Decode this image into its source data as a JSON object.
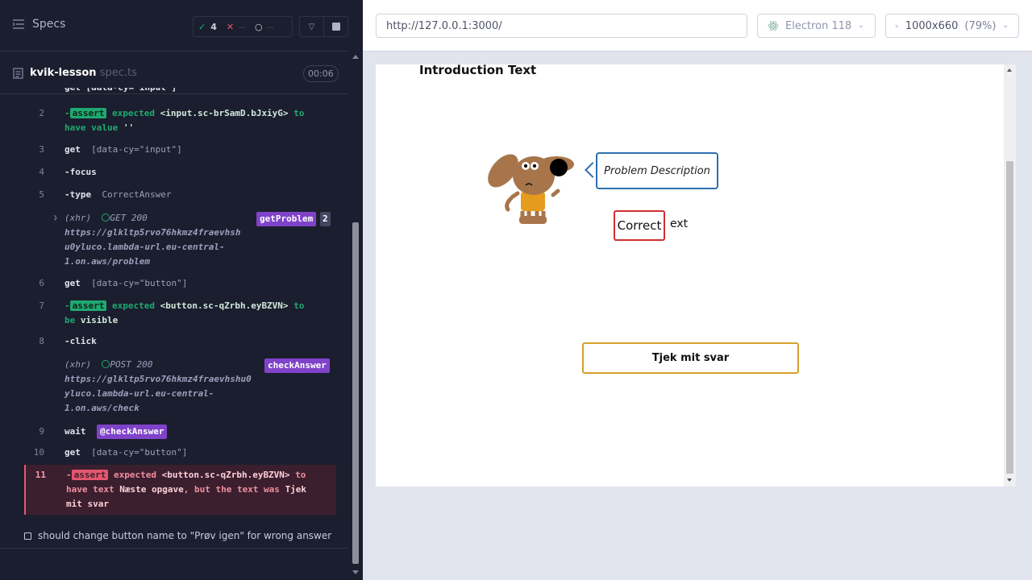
{
  "reporter": {
    "specs_label": "Specs",
    "stats": {
      "passed": "4",
      "failed": "--",
      "pending": "--"
    },
    "spec": {
      "name": "kvik-lesson",
      "ext": "spec.ts",
      "duration": "00:06"
    },
    "commands": [
      {
        "num": "2",
        "badge": "assert",
        "line1_a": "expected",
        "line1_b": "<input.sc-brSamD.bJxiyG>",
        "line1_c": "to",
        "line2_a": "have value",
        "line2_b": "''"
      },
      {
        "num": "3",
        "name": "get",
        "arg": "[data-cy=\"input\"]"
      },
      {
        "num": "4",
        "name": "-focus"
      },
      {
        "num": "5",
        "name": "-type",
        "arg": "CorrectAnswer"
      },
      {
        "xhr": "(xhr)",
        "status": "GET 200",
        "alias": "getProblem",
        "count": "2",
        "url1": "https://glkltp5rvo76hkmz4fraevhsh",
        "url2": "u0yluco.lambda-url.eu-central-",
        "url3": "1.on.aws/problem"
      },
      {
        "num": "6",
        "name": "get",
        "arg": "[data-cy=\"button\"]"
      },
      {
        "num": "7",
        "badge": "assert",
        "line1_a": "expected",
        "line1_b": "<button.sc-qZrbh.eyBZVN>",
        "line1_c": "to",
        "line2_a": "be",
        "line2_b": "visible"
      },
      {
        "num": "8",
        "name": "-click"
      },
      {
        "xhr": "(xhr)",
        "status": "POST 200",
        "alias": "checkAnswer",
        "url1": "https://glkltp5rvo76hkmz4fraevhshu0",
        "url2": "yluco.lambda-url.eu-central-",
        "url3": "1.on.aws/check"
      },
      {
        "num": "9",
        "name": "wait",
        "alias": "@checkAnswer"
      },
      {
        "num": "10",
        "name": "get",
        "arg": "[data-cy=\"button\"]"
      },
      {
        "num": "11",
        "badge": "assert",
        "line1_a": "expected",
        "line1_b": "<button.sc-qZrbh.eyBZVN>",
        "line1_c": "to",
        "line2_a": "have text",
        "line2_b": "Næste opgave",
        "line2_c": ", but the text was",
        "line2_d": "Tjek",
        "line3": "mit svar"
      }
    ],
    "pending_test": "should change button name to \"Prøv igen\" for wrong answer"
  },
  "aut": {
    "url": "http://127.0.0.1:3000/",
    "browser": "Electron 118",
    "viewport": "1000x660",
    "zoom": "(79%)",
    "page": {
      "title": "Introduction Text",
      "bubble": "Problem Description",
      "input_value": "Correct",
      "after_input": "ext",
      "button": "Tjek mit svar"
    }
  },
  "colors": {
    "pass": "#1fa971",
    "fail": "#e45770",
    "alias": "#7f43c9",
    "bubble_border": "#2d6fae",
    "input_border": "#d32f2f",
    "button_border": "#d4a02c"
  }
}
